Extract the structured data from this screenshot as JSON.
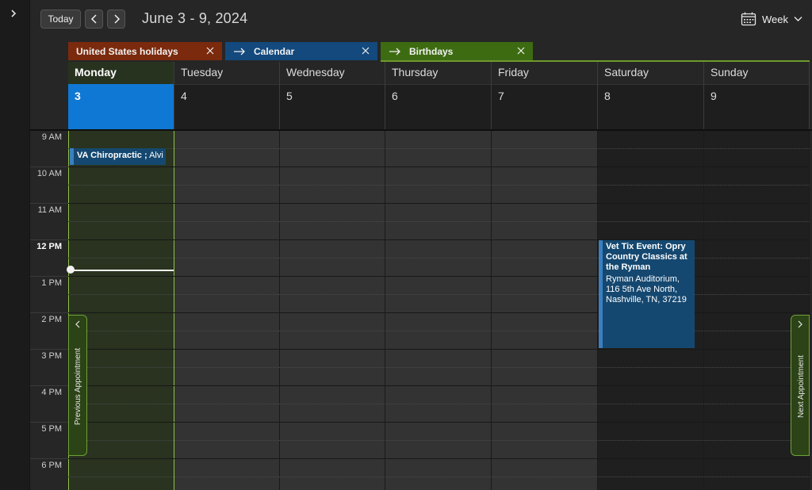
{
  "toolbar": {
    "today_label": "Today",
    "date_range": "June 3 - 9, 2024",
    "view_label": "Week"
  },
  "calendars": [
    {
      "label": "United States holidays",
      "color": "#7b2a0e"
    },
    {
      "label": "Calendar",
      "color": "#13497d"
    },
    {
      "label": "Birthdays",
      "color": "#3d6b12"
    }
  ],
  "days": [
    {
      "name": "Monday",
      "num": "3",
      "today": true
    },
    {
      "name": "Tuesday",
      "num": "4"
    },
    {
      "name": "Wednesday",
      "num": "5"
    },
    {
      "name": "Thursday",
      "num": "6"
    },
    {
      "name": "Friday",
      "num": "7"
    },
    {
      "name": "Saturday",
      "num": "8"
    },
    {
      "name": "Sunday",
      "num": "9"
    }
  ],
  "times": [
    "9 AM",
    "10 AM",
    "11 AM",
    "12 PM",
    "1 PM",
    "2 PM",
    "3 PM",
    "4 PM",
    "5 PM",
    "6 PM"
  ],
  "events": [
    {
      "title": "VA Chiropractic ;",
      "organizer": "Alvi",
      "day": "Monday",
      "start": "9 AM"
    },
    {
      "title": "Vet Tix Event: Opry Country Classics at the Ryman",
      "location": "Ryman Auditorium, 116 5th Ave North, Nashville, TN, 37219",
      "day": "Saturday",
      "start": "12 PM"
    }
  ],
  "side_nav": {
    "prev_label": "Previous Appointment",
    "next_label": "Next Appointment"
  },
  "colors": {
    "today_accent": "#0f78d4",
    "today_column": "#29331f",
    "event_bg": "#154870"
  }
}
